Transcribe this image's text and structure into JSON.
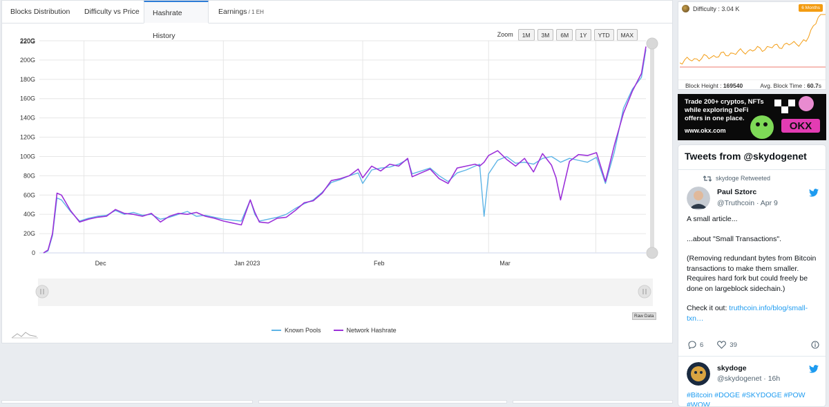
{
  "tabs": [
    {
      "label": "Blocks Distribution",
      "active": false
    },
    {
      "label": "Difficulty vs Price",
      "active": false
    },
    {
      "label": "Hashrate History",
      "active": true
    },
    {
      "label": "Earnings",
      "sub": " / 1 EH",
      "active": false
    }
  ],
  "zoom": {
    "label": "Zoom",
    "buttons": [
      "1M",
      "3M",
      "6M",
      "1Y",
      "YTD",
      "MAX"
    ]
  },
  "raw_data_label": "Raw Data",
  "colors": {
    "known_pools": "#5db4e6",
    "network_hashrate": "#9b30d9",
    "accent": "#2b7bd6",
    "badge": "#f39c12"
  },
  "chart_data": {
    "type": "line",
    "ytick_labels": [
      "0",
      "20G",
      "40G",
      "60G",
      "80G",
      "100G",
      "120G",
      "140G",
      "160G",
      "180G",
      "200G",
      "220G"
    ],
    "yticks": [
      0,
      20,
      40,
      60,
      80,
      100,
      120,
      140,
      160,
      180,
      200,
      220
    ],
    "ylim": [
      0,
      220
    ],
    "xlim": [
      "2022-11-22",
      "2023-03-27"
    ],
    "xtick_labels": [
      "Dec",
      "Jan 2023",
      "Feb",
      "Mar"
    ],
    "xticks": [
      "2022-12-01",
      "2023-01-01",
      "2023-02-01",
      "2023-03-01"
    ],
    "grid": true,
    "legend_position": "bottom",
    "series": [
      {
        "name": "Known Pools",
        "color": "#5db4e6",
        "points": [
          [
            "2022-11-22",
            0
          ],
          [
            "2022-11-23",
            2
          ],
          [
            "2022-11-24",
            18
          ],
          [
            "2022-11-25",
            57
          ],
          [
            "2022-11-26",
            55
          ],
          [
            "2022-11-28",
            43
          ],
          [
            "2022-11-30",
            33
          ],
          [
            "2022-12-02",
            36
          ],
          [
            "2022-12-04",
            38
          ],
          [
            "2022-12-06",
            39
          ],
          [
            "2022-12-08",
            44
          ],
          [
            "2022-12-10",
            40
          ],
          [
            "2022-12-12",
            42
          ],
          [
            "2022-12-14",
            39
          ],
          [
            "2022-12-16",
            40
          ],
          [
            "2022-12-18",
            35
          ],
          [
            "2022-12-20",
            37
          ],
          [
            "2022-12-22",
            40
          ],
          [
            "2022-12-24",
            43
          ],
          [
            "2022-12-26",
            38
          ],
          [
            "2022-12-28",
            39
          ],
          [
            "2022-12-30",
            37
          ],
          [
            "2023-01-01",
            35
          ],
          [
            "2023-01-03",
            34
          ],
          [
            "2023-01-05",
            33
          ],
          [
            "2023-01-07",
            55
          ],
          [
            "2023-01-08",
            40
          ],
          [
            "2023-01-09",
            33
          ],
          [
            "2023-01-11",
            35
          ],
          [
            "2023-01-13",
            37
          ],
          [
            "2023-01-15",
            40
          ],
          [
            "2023-01-17",
            46
          ],
          [
            "2023-01-19",
            51
          ],
          [
            "2023-01-21",
            55
          ],
          [
            "2023-01-23",
            63
          ],
          [
            "2023-01-25",
            73
          ],
          [
            "2023-01-27",
            76
          ],
          [
            "2023-01-29",
            80
          ],
          [
            "2023-01-31",
            83
          ],
          [
            "2023-02-01",
            72
          ],
          [
            "2023-02-03",
            86
          ],
          [
            "2023-02-05",
            88
          ],
          [
            "2023-02-07",
            89
          ],
          [
            "2023-02-09",
            92
          ],
          [
            "2023-02-11",
            97
          ],
          [
            "2023-02-12",
            82
          ],
          [
            "2023-02-14",
            85
          ],
          [
            "2023-02-16",
            88
          ],
          [
            "2023-02-18",
            80
          ],
          [
            "2023-02-20",
            74
          ],
          [
            "2023-02-22",
            83
          ],
          [
            "2023-02-24",
            86
          ],
          [
            "2023-02-26",
            90
          ],
          [
            "2023-02-27",
            92
          ],
          [
            "2023-02-28",
            38
          ],
          [
            "2023-03-01",
            82
          ],
          [
            "2023-03-03",
            96
          ],
          [
            "2023-03-05",
            100
          ],
          [
            "2023-03-07",
            93
          ],
          [
            "2023-03-09",
            94
          ],
          [
            "2023-03-11",
            92
          ],
          [
            "2023-03-13",
            98
          ],
          [
            "2023-03-15",
            100
          ],
          [
            "2023-03-16",
            97
          ],
          [
            "2023-03-17",
            94
          ],
          [
            "2023-03-19",
            98
          ],
          [
            "2023-03-21",
            96
          ],
          [
            "2023-03-23",
            94
          ],
          [
            "2023-03-25",
            99
          ],
          [
            "2023-03-27",
            72
          ],
          [
            "2023-03-29",
            105
          ],
          [
            "2023-03-31",
            150
          ],
          [
            "2023-04-02",
            170
          ],
          [
            "2023-04-04",
            182
          ],
          [
            "2023-04-05",
            211
          ]
        ]
      },
      {
        "name": "Network Hashrate",
        "color": "#9b30d9",
        "points": [
          [
            "2022-11-22",
            0
          ],
          [
            "2022-11-23",
            3
          ],
          [
            "2022-11-24",
            20
          ],
          [
            "2022-11-25",
            62
          ],
          [
            "2022-11-26",
            60
          ],
          [
            "2022-11-28",
            44
          ],
          [
            "2022-11-30",
            32
          ],
          [
            "2022-12-02",
            35
          ],
          [
            "2022-12-04",
            37
          ],
          [
            "2022-12-06",
            38
          ],
          [
            "2022-12-08",
            45
          ],
          [
            "2022-12-10",
            41
          ],
          [
            "2022-12-12",
            40
          ],
          [
            "2022-12-14",
            38
          ],
          [
            "2022-12-16",
            41
          ],
          [
            "2022-12-18",
            32
          ],
          [
            "2022-12-20",
            38
          ],
          [
            "2022-12-22",
            41
          ],
          [
            "2022-12-24",
            40
          ],
          [
            "2022-12-26",
            42
          ],
          [
            "2022-12-28",
            38
          ],
          [
            "2022-12-30",
            36
          ],
          [
            "2023-01-01",
            33
          ],
          [
            "2023-01-03",
            31
          ],
          [
            "2023-01-05",
            29
          ],
          [
            "2023-01-07",
            55
          ],
          [
            "2023-01-08",
            42
          ],
          [
            "2023-01-09",
            32
          ],
          [
            "2023-01-11",
            31
          ],
          [
            "2023-01-13",
            36
          ],
          [
            "2023-01-15",
            37
          ],
          [
            "2023-01-17",
            44
          ],
          [
            "2023-01-19",
            52
          ],
          [
            "2023-01-21",
            54
          ],
          [
            "2023-01-23",
            62
          ],
          [
            "2023-01-25",
            75
          ],
          [
            "2023-01-27",
            77
          ],
          [
            "2023-01-29",
            80
          ],
          [
            "2023-01-31",
            87
          ],
          [
            "2023-02-01",
            78
          ],
          [
            "2023-02-03",
            90
          ],
          [
            "2023-02-05",
            85
          ],
          [
            "2023-02-07",
            92
          ],
          [
            "2023-02-09",
            90
          ],
          [
            "2023-02-11",
            98
          ],
          [
            "2023-02-12",
            79
          ],
          [
            "2023-02-14",
            83
          ],
          [
            "2023-02-16",
            87
          ],
          [
            "2023-02-18",
            77
          ],
          [
            "2023-02-20",
            72
          ],
          [
            "2023-02-22",
            88
          ],
          [
            "2023-02-24",
            90
          ],
          [
            "2023-02-26",
            92
          ],
          [
            "2023-02-27",
            90
          ],
          [
            "2023-02-28",
            94
          ],
          [
            "2023-03-01",
            101
          ],
          [
            "2023-03-03",
            106
          ],
          [
            "2023-03-05",
            97
          ],
          [
            "2023-03-07",
            90
          ],
          [
            "2023-03-09",
            98
          ],
          [
            "2023-03-11",
            84
          ],
          [
            "2023-03-13",
            103
          ],
          [
            "2023-03-15",
            91
          ],
          [
            "2023-03-16",
            78
          ],
          [
            "2023-03-17",
            55
          ],
          [
            "2023-03-19",
            95
          ],
          [
            "2023-03-21",
            102
          ],
          [
            "2023-03-23",
            101
          ],
          [
            "2023-03-25",
            104
          ],
          [
            "2023-03-27",
            74
          ],
          [
            "2023-03-29",
            112
          ],
          [
            "2023-03-31",
            145
          ],
          [
            "2023-04-02",
            168
          ],
          [
            "2023-04-04",
            186
          ],
          [
            "2023-04-05",
            214
          ]
        ]
      }
    ]
  },
  "difficulty": {
    "label": "Difficulty : 3.04 K",
    "badge": "6 Months",
    "block_height_label": "Block Height : ",
    "block_height_value": "169540",
    "avg_block_time_label": "Avg. Block Time : ",
    "avg_block_time_value": "60.7",
    "avg_block_time_unit": "s"
  },
  "ad": {
    "text": "Trade 200+ cryptos, NFTs while exploring DeFi offers in one place.",
    "url": "www.okx.com",
    "logo_text": "OKX"
  },
  "twitter": {
    "title": "Tweets from @skydogenet",
    "retweet_label": "skydoge Retweeted",
    "tweet1": {
      "name": "Paul Sztorc",
      "handle": "@Truthcoin · Apr 9",
      "lines": [
        "A small article...",
        "",
        "...about \"Small Transactions\".",
        "",
        "(Removing redundant bytes from Bitcoin transactions to make them smaller. Requires hard fork but could freely be done on largeblock sidechain.)",
        "",
        "Check it out: "
      ],
      "link": "truthcoin.info/blog/small-txn…",
      "replies": "6",
      "likes": "39"
    },
    "tweet2": {
      "name": "skydoge",
      "handle": "@skydogenet · 16h",
      "hashtags": "#Bitcoin #DOGE #SKYDOGE #POW #WOW"
    }
  }
}
